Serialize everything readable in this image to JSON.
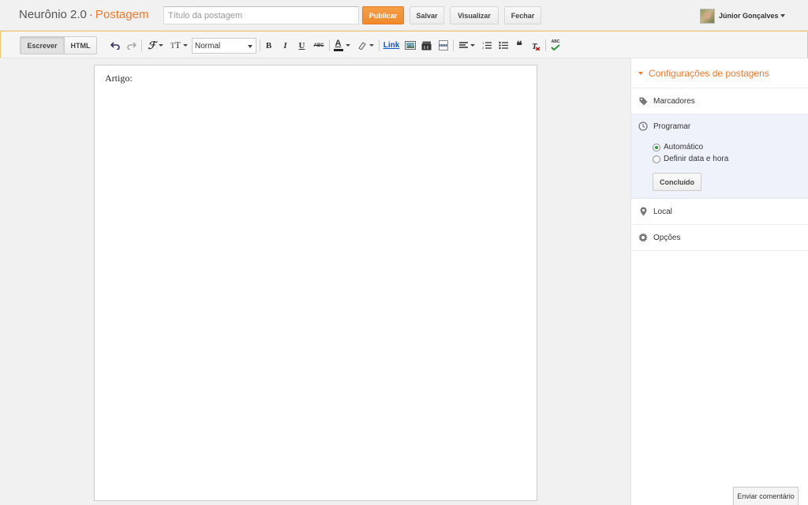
{
  "header": {
    "blog_name": "Neurônio 2.0",
    "separator": "·",
    "page_label": "Postagem",
    "title_placeholder": "Título da postagem",
    "title_value": "",
    "publish_label": "Publicar",
    "save_label": "Salvar",
    "preview_label": "Visualizar",
    "close_label": "Fechar",
    "user_name": "Júnior Gonçalves"
  },
  "toolbar": {
    "write_label": "Escrever",
    "html_label": "HTML",
    "font_size_value": "Normal",
    "bold": "B",
    "italic": "I",
    "underline": "U",
    "strike": "ABC",
    "text_color": "A",
    "link": "Link",
    "spell": "ABC"
  },
  "editor": {
    "content": "Artigo:"
  },
  "sidebar": {
    "heading": "Configurações de postagens",
    "labels_item": "Marcadores",
    "schedule_title": "Programar",
    "schedule_options": [
      "Automático",
      "Definir data e hora"
    ],
    "done_label": "Concluído",
    "location_item": "Local",
    "options_item": "Opções"
  },
  "feedback": {
    "label": "Enviar comentário"
  },
  "colors": {
    "accent": "#f07a2b",
    "publish": "#f18a2b",
    "selected_radio": "#2b9a3b"
  }
}
